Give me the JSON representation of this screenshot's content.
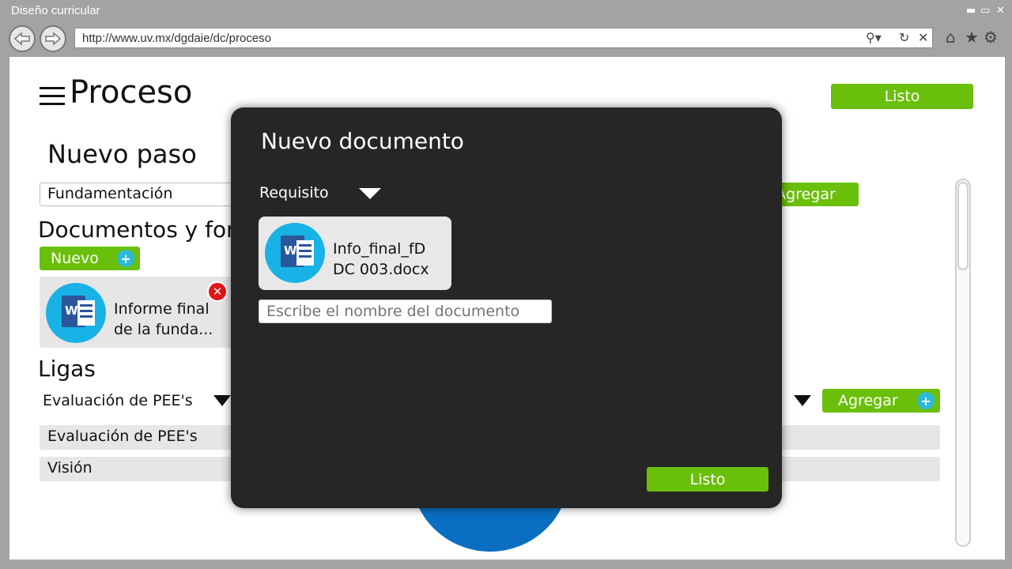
{
  "window": {
    "title": "Diseño curricular"
  },
  "browser": {
    "url": "http://www.uv.mx/dgdaie/dc/proceso"
  },
  "header": {
    "title": "Proceso",
    "done_label": "Listo"
  },
  "step": {
    "heading": "Nuevo paso",
    "name_value": "Fundamentación",
    "add_label": "Agregar"
  },
  "documents": {
    "heading": "Documentos y formatos",
    "new_label": "Nuevo",
    "items": [
      {
        "name": "Informe final de la funda..."
      }
    ]
  },
  "links": {
    "heading": "Ligas",
    "select_value": "Evaluación de PEE's",
    "add_label": "Agregar",
    "items": [
      {
        "label": "Evaluación de PEE's"
      },
      {
        "label": "Visión"
      }
    ]
  },
  "modal": {
    "title": "Nuevo documento",
    "type_value": "Requisito",
    "file_name": "Info_final_fDDC 003.docx",
    "file_name_line1": "Info_final_fD",
    "file_name_line2": "DC 003.docx",
    "name_placeholder": "Escribe el nombre del documento",
    "done_label": "Listo"
  },
  "colors": {
    "accent": "#6abf0a",
    "modal_bg": "#262626",
    "word_circle": "#19b2e6",
    "word_blue": "#2b579a"
  },
  "icons": [
    "menu-icon",
    "word-icon",
    "remove-icon",
    "plus-icon",
    "dropdown-arrow-icon",
    "back-icon",
    "forward-icon",
    "search-icon",
    "refresh-icon",
    "close-icon",
    "home-icon",
    "star-icon",
    "gear-icon"
  ]
}
